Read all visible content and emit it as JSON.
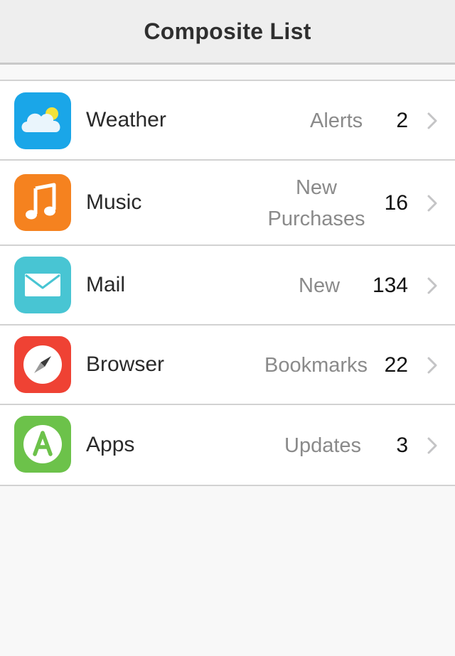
{
  "navbar": {
    "title": "Composite List"
  },
  "rows": [
    {
      "title": "Weather",
      "subtitle": "Alerts",
      "count": "2",
      "icon": "weather-cloud-sun-icon",
      "color": "#1aa6e8"
    },
    {
      "title": "Music",
      "subtitle_line1": "New",
      "subtitle_line2": "Purchases",
      "count": "16",
      "icon": "music-note-icon",
      "color": "#f5821f"
    },
    {
      "title": "Mail",
      "subtitle": "New",
      "count": "134",
      "icon": "mail-envelope-icon",
      "color": "#48c5d3"
    },
    {
      "title": "Browser",
      "subtitle": "Bookmarks",
      "count": "22",
      "icon": "compass-icon",
      "color": "#ef4234"
    },
    {
      "title": "Apps",
      "subtitle": "Updates",
      "count": "3",
      "icon": "app-store-a-icon",
      "color": "#6cc24a"
    }
  ]
}
